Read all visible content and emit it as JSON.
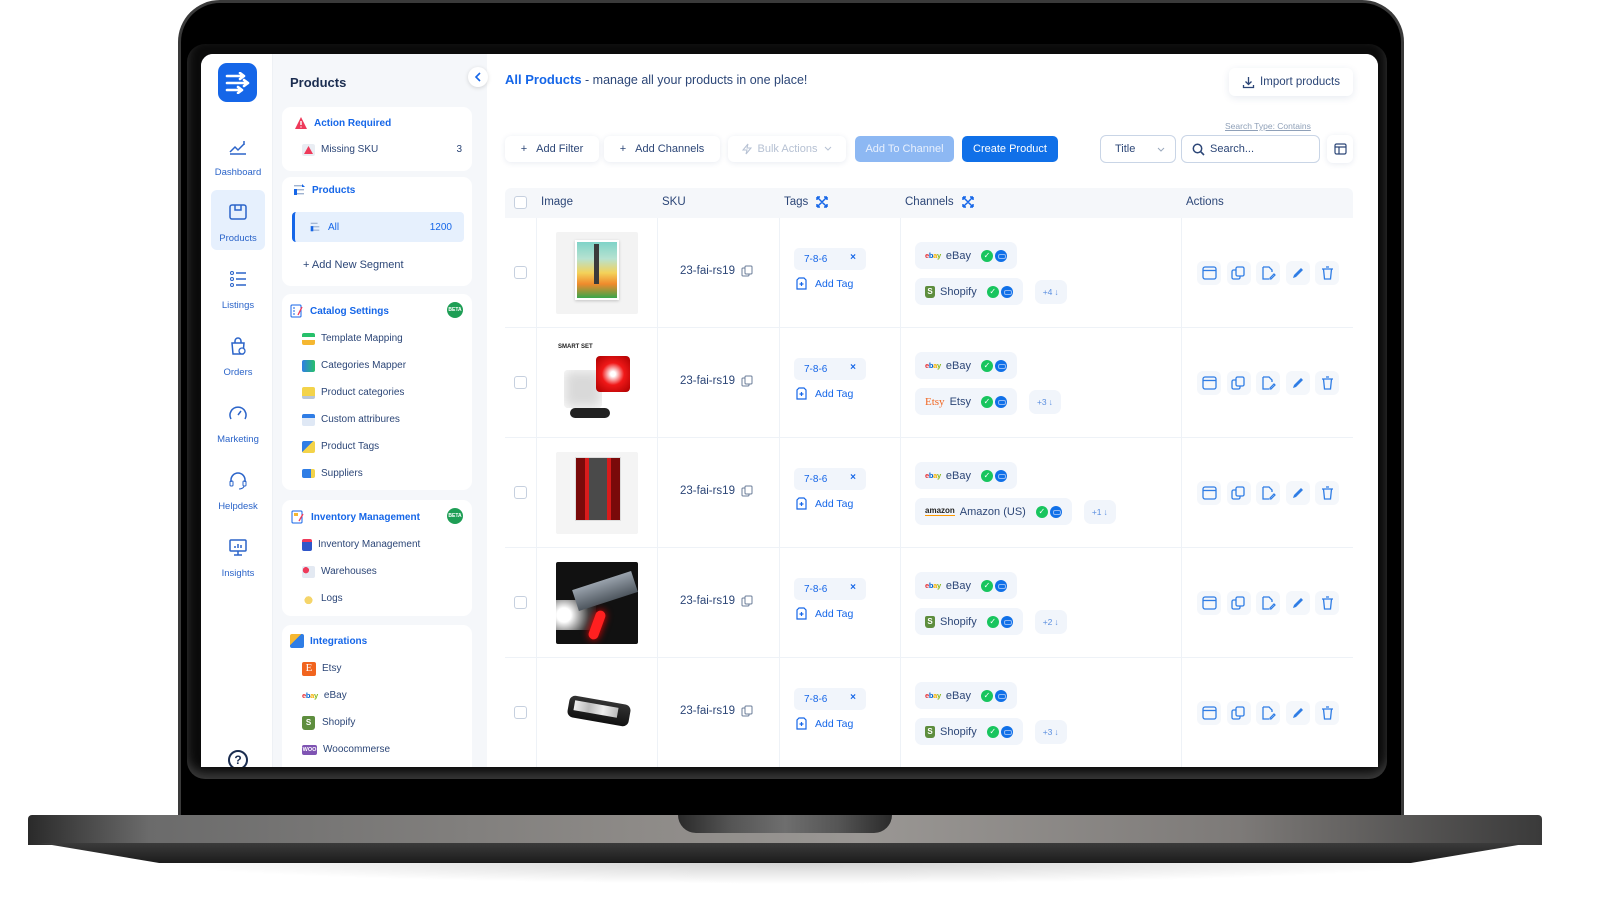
{
  "app": {
    "rail": [
      {
        "label": "Dashboard",
        "icon": "chart-line-icon",
        "active": false
      },
      {
        "label": "Products",
        "icon": "box-icon",
        "active": true
      },
      {
        "label": "Listings",
        "icon": "list-icon",
        "active": false
      },
      {
        "label": "Orders",
        "icon": "shopping-bag-icon",
        "active": false
      },
      {
        "label": "Marketing",
        "icon": "speedometer-icon",
        "active": false
      },
      {
        "label": "Helpdesk",
        "icon": "headset-icon",
        "active": false
      },
      {
        "label": "Insights",
        "icon": "monitor-chart-icon",
        "active": false
      }
    ],
    "help_label": "?"
  },
  "sidebar": {
    "title": "Products",
    "action_required": {
      "title": "Action Required",
      "items": [
        {
          "label": "Missing SKU",
          "count": "3"
        }
      ]
    },
    "products": {
      "title": "Products",
      "all_label": "All",
      "all_count": "1200",
      "add_segment": "+  Add New Segment"
    },
    "catalog_settings": {
      "title": "Catalog Settings",
      "badge": "BETA",
      "items": [
        "Template Mapping",
        "Categories Mapper",
        "Product categories",
        "Custom attribures",
        "Product Tags",
        "Suppliers"
      ]
    },
    "inventory": {
      "title": "Inventory Management",
      "badge": "BETA",
      "items": [
        "Inventory Management",
        "Warehouses",
        "Logs"
      ]
    },
    "integrations": {
      "title": "Integrations",
      "items": [
        "Etsy",
        "eBay",
        "Shopify",
        "Woocommerse"
      ]
    }
  },
  "main": {
    "title": "All Products",
    "subtitle": " - manage all your products in one place!",
    "import_label": "Import products",
    "toolbar": {
      "add_filter": "Add Filter",
      "add_channels": "Add Channels",
      "bulk_actions": "Bulk Actions",
      "add_to_channel": "Add To Channel",
      "create_product": "Create Product",
      "search_type": "Search Type: Contains",
      "select_value": "Title",
      "search_placeholder": "Search..."
    },
    "table": {
      "headers": {
        "image": "Image",
        "sku": "SKU",
        "tags": "Tags",
        "channels": "Channels",
        "actions": "Actions"
      },
      "add_tag_label": "Add Tag",
      "rows": [
        {
          "image": "rocket-poster",
          "sku": "23-fai-rs19",
          "tag": "7-8-6",
          "channels": [
            {
              "logo": "ebay",
              "name": "eBay"
            },
            {
              "logo": "shopify",
              "name": "Shopify"
            }
          ],
          "more": "+4"
        },
        {
          "image": "bike-light-set",
          "sku": "23-fai-rs19",
          "tag": "7-8-6",
          "channels": [
            {
              "logo": "ebay",
              "name": "eBay"
            },
            {
              "logo": "etsy",
              "name": "Etsy"
            }
          ],
          "more": "+3"
        },
        {
          "image": "bridge-poster",
          "sku": "23-fai-rs19",
          "tag": "7-8-6",
          "channels": [
            {
              "logo": "ebay",
              "name": "eBay"
            },
            {
              "logo": "amazon",
              "name": "Amazon (US)"
            }
          ],
          "more": "+1"
        },
        {
          "image": "bike-headlight",
          "sku": "23-fai-rs19",
          "tag": "7-8-6",
          "channels": [
            {
              "logo": "ebay",
              "name": "eBay"
            },
            {
              "logo": "shopify",
              "name": "Shopify"
            }
          ],
          "more": "+2"
        },
        {
          "image": "front-light",
          "sku": "23-fai-rs19",
          "tag": "7-8-6",
          "channels": [
            {
              "logo": "ebay",
              "name": "eBay"
            },
            {
              "logo": "shopify",
              "name": "Shopify"
            }
          ],
          "more": "+3"
        }
      ]
    }
  },
  "colors": {
    "accent": "#1566e8",
    "primary_button": "#1070e8",
    "text": "#2c4677",
    "success": "#18c55e",
    "background": "#f5f7fa"
  }
}
